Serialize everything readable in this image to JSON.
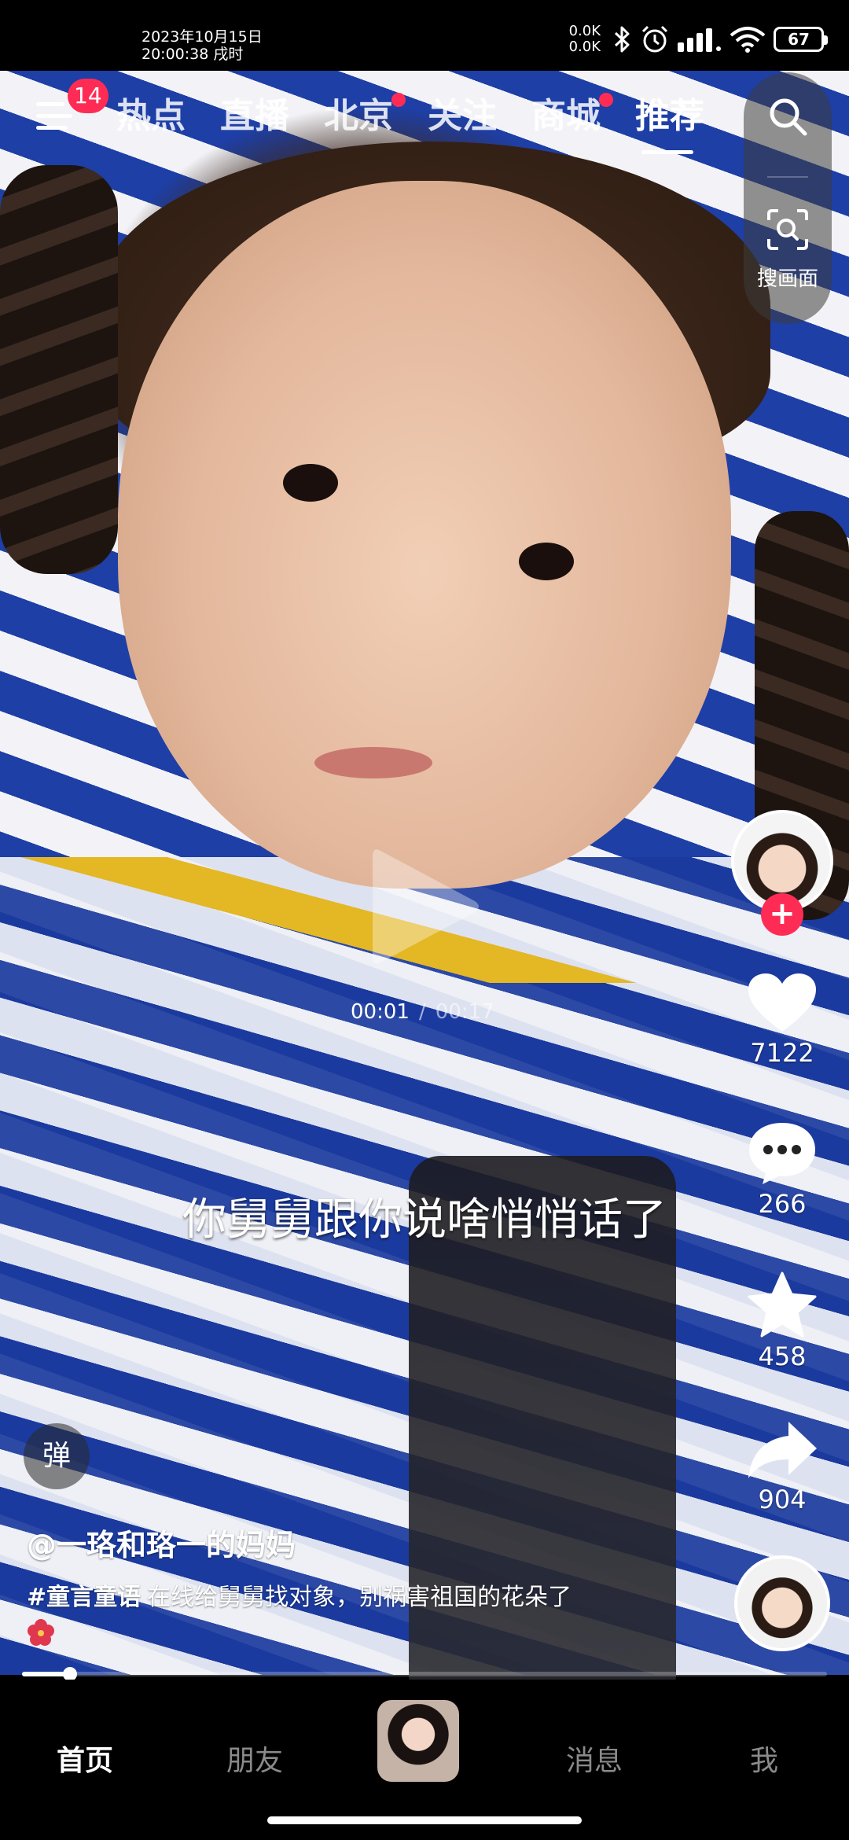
{
  "status_bar": {
    "date": "2023年10月15日",
    "time": "20:00:38 戌时",
    "net_up": "0.0K",
    "net_down": "0.0K",
    "battery": "67",
    "icons": [
      "bluetooth-icon",
      "alarm-icon",
      "signal-icon",
      "wifi-icon",
      "battery-icon"
    ]
  },
  "top_nav": {
    "menu_badge": "14",
    "tabs": [
      {
        "label": "热点",
        "dot": false
      },
      {
        "label": "直播",
        "dot": false
      },
      {
        "label": "北京",
        "dot": true
      },
      {
        "label": "关注",
        "dot": false
      },
      {
        "label": "商城",
        "dot": true
      },
      {
        "label": "推荐",
        "dot": false
      }
    ],
    "active_tab": "推荐",
    "search_screen_label": "搜画面"
  },
  "player": {
    "current_time": "00:01",
    "separator": "/",
    "total_time": "00:17",
    "progress_fraction": 0.06,
    "caption": "你舅舅跟你说啥悄悄话了"
  },
  "actions": {
    "likes": "7122",
    "comments": "266",
    "favorites": "458",
    "shares": "904"
  },
  "post": {
    "danmu_label": "弹",
    "author": "@一珞和珞一的妈妈",
    "hashtag": "#童言童语",
    "description": "在线给舅舅找对象，别祸害祖国的花朵了",
    "emoji": "hibiscus-emoji"
  },
  "bottom_nav": {
    "items": [
      "首页",
      "朋友",
      "消息",
      "我"
    ],
    "active": "首页"
  },
  "colors": {
    "accent": "#fe2c55",
    "background": "#000000"
  }
}
